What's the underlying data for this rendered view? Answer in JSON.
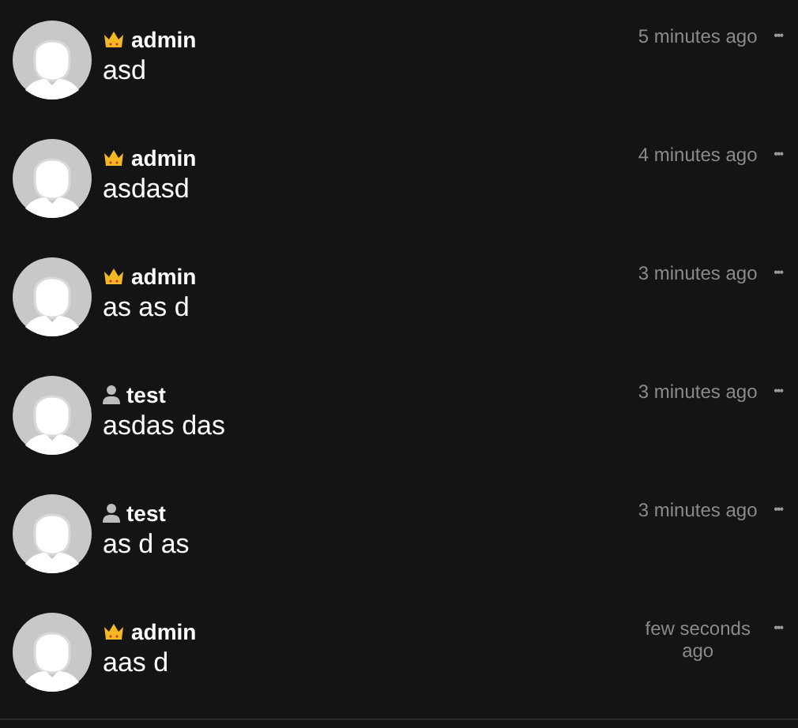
{
  "comments": [
    {
      "kind": "admin",
      "author": "admin",
      "text": "asd",
      "time": "5 minutes ago",
      "menu": "•••"
    },
    {
      "kind": "admin",
      "author": "admin",
      "text": "asdasd",
      "time": "4 minutes ago",
      "menu": "•••"
    },
    {
      "kind": "admin",
      "author": "admin",
      "text": "as as d",
      "time": "3 minutes ago",
      "menu": "•••"
    },
    {
      "kind": "user",
      "author": "test",
      "text": "asdas das",
      "time": "3 minutes ago",
      "menu": "•••"
    },
    {
      "kind": "user",
      "author": "test",
      "text": "as d as",
      "time": "3 minutes ago",
      "menu": "•••"
    },
    {
      "kind": "admin",
      "author": "admin",
      "text": "aas d",
      "time": "few seconds ago",
      "menu": "•••"
    }
  ]
}
